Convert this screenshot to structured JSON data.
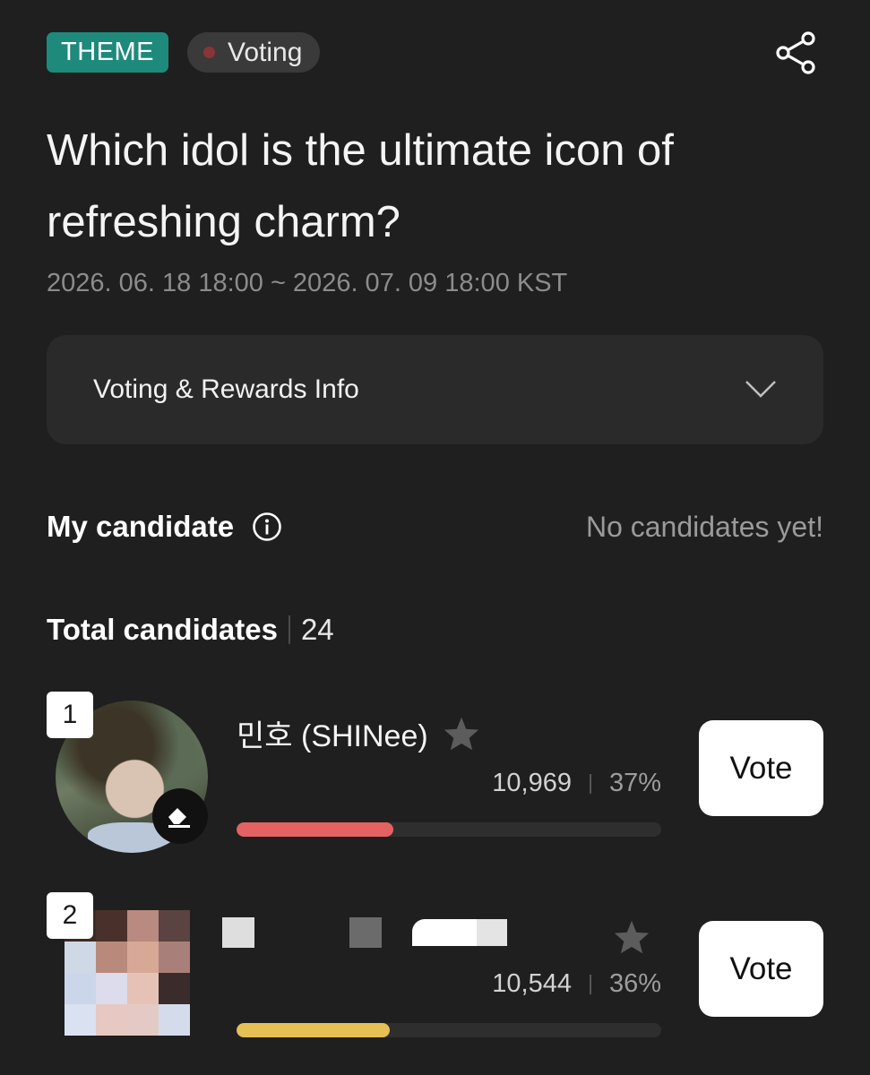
{
  "header": {
    "theme_badge": "THEME",
    "status_label": "Voting",
    "status_dot_color": "#8a3535",
    "share_icon": "share-icon"
  },
  "poll": {
    "title": "Which idol is the ultimate icon of refreshing charm?",
    "period": "2026. 06. 18 18:00 ~ 2026. 07. 09 18:00 KST"
  },
  "info_panel": {
    "label": "Voting & Rewards Info",
    "icon": "chevron-down-icon"
  },
  "my_candidate": {
    "title": "My candidate",
    "icon": "info-icon",
    "empty_text": "No candidates yet!"
  },
  "total": {
    "label": "Total candidates",
    "count": "24"
  },
  "candidates": [
    {
      "rank": "1",
      "name": "민호 (SHINee)",
      "votes": "10,969",
      "percent": "37%",
      "bar_fraction": 0.37,
      "bar_color": "#e46262",
      "vote_label": "Vote",
      "favorited": false
    },
    {
      "rank": "2",
      "name": "",
      "votes": "10,544",
      "percent": "36%",
      "bar_fraction": 0.36,
      "bar_color": "#e6bf55",
      "vote_label": "Vote",
      "favorited": false
    }
  ],
  "colors": {
    "background": "#1f1f1f",
    "theme_badge": "#1e8a7c",
    "panel": "#2a2a2a"
  }
}
